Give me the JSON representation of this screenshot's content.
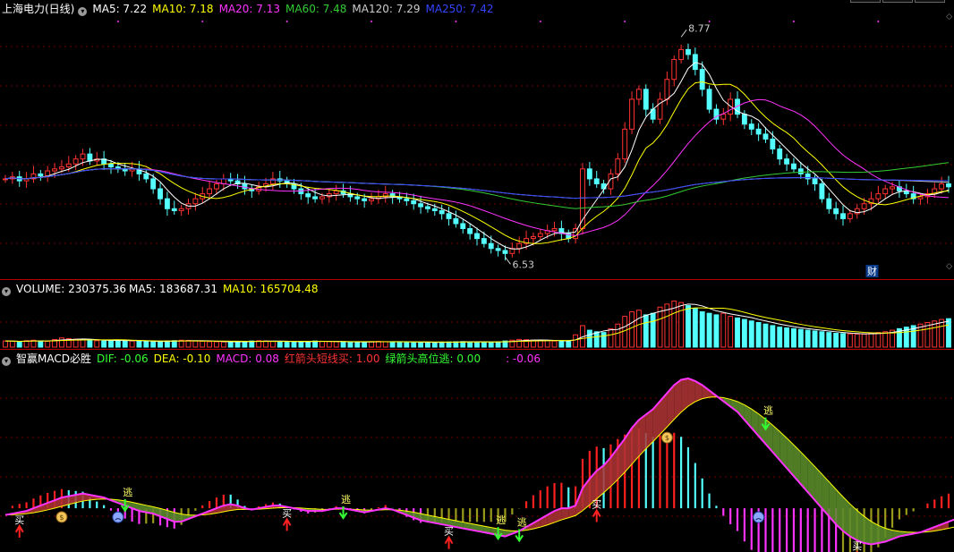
{
  "price": {
    "title": "上海电力(日线)",
    "ma": [
      {
        "label": "MA5: 7.22",
        "color": "#ffffff"
      },
      {
        "label": "MA10: 7.18",
        "color": "#ffff00"
      },
      {
        "label": "MA20: 7.13",
        "color": "#ff33ff"
      },
      {
        "label": "MA60: 7.48",
        "color": "#33cc33"
      },
      {
        "label": "MA120: 7.29",
        "color": "#cccccc"
      },
      {
        "label": "MA250: 7.42",
        "color": "#3344ff"
      }
    ],
    "high_label": "8.77",
    "low_label": "6.53",
    "cai_badge": "财"
  },
  "volume": {
    "items": [
      {
        "label": "VOLUME: 230375.36",
        "color": "#ffffff"
      },
      {
        "label": "MA5: 183687.31",
        "color": "#ffffff"
      },
      {
        "label": "MA10: 165704.48",
        "color": "#ffff00"
      }
    ]
  },
  "macd": {
    "title": "智赢MACD必胜",
    "items": [
      {
        "label": "DIF: -0.06",
        "color": "#33ff33"
      },
      {
        "label": "DEA: -0.10",
        "color": "#ffff00"
      },
      {
        "label": "MACD: 0.08",
        "color": "#ff33ff"
      },
      {
        "label": "红箭头短线买: 1.00",
        "color": "#ff3333"
      },
      {
        "label": "绿箭头高位逃: 0.00",
        "color": "#33ff33"
      },
      {
        "label": ": -0.06",
        "color": "#ff33ff"
      }
    ],
    "buy_label": "买",
    "sell_label": "逃"
  },
  "chart_data": {
    "type": "candlestick",
    "close": [
      7.3,
      7.32,
      7.28,
      7.3,
      7.35,
      7.33,
      7.38,
      7.4,
      7.42,
      7.45,
      7.5,
      7.55,
      7.48,
      7.5,
      7.45,
      7.42,
      7.4,
      7.38,
      7.4,
      7.35,
      7.3,
      7.2,
      7.1,
      7.0,
      6.98,
      7.0,
      7.05,
      7.1,
      7.15,
      7.2,
      7.25,
      7.3,
      7.28,
      7.25,
      7.2,
      7.18,
      7.22,
      7.25,
      7.3,
      7.28,
      7.25,
      7.2,
      7.15,
      7.12,
      7.1,
      7.12,
      7.15,
      7.18,
      7.15,
      7.12,
      7.1,
      7.08,
      7.1,
      7.12,
      7.15,
      7.12,
      7.1,
      7.08,
      7.05,
      7.02,
      7.0,
      6.98,
      6.95,
      6.9,
      6.85,
      6.8,
      6.75,
      6.7,
      6.65,
      6.6,
      6.58,
      6.55,
      6.6,
      6.65,
      6.7,
      6.72,
      6.75,
      6.78,
      6.8,
      6.75,
      6.7,
      6.8,
      7.4,
      7.3,
      7.25,
      7.2,
      7.35,
      7.5,
      7.8,
      8.1,
      8.2,
      8.0,
      7.9,
      8.1,
      8.3,
      8.5,
      8.6,
      8.55,
      8.4,
      8.2,
      8.0,
      7.9,
      7.95,
      8.1,
      7.95,
      7.85,
      7.8,
      7.75,
      7.7,
      7.6,
      7.5,
      7.45,
      7.4,
      7.35,
      7.3,
      7.25,
      7.1,
      7.0,
      6.95,
      6.9,
      6.95,
      7.0,
      7.05,
      7.1,
      7.15,
      7.2,
      7.22,
      7.18,
      7.15,
      7.1,
      7.12,
      7.15,
      7.2,
      7.25,
      7.22
    ],
    "ylim": [
      6.4,
      8.9
    ],
    "volume": [
      40,
      38,
      35,
      42,
      45,
      40,
      38,
      50,
      60,
      55,
      52,
      48,
      45,
      42,
      40,
      44,
      46,
      42,
      40,
      38,
      36,
      35,
      38,
      40,
      42,
      45,
      44,
      40,
      38,
      36,
      35,
      34,
      33,
      36,
      38,
      40,
      42,
      40,
      38,
      36,
      35,
      34,
      36,
      38,
      40,
      38,
      36,
      35,
      34,
      33,
      32,
      34,
      36,
      38,
      36,
      35,
      34,
      33,
      32,
      30,
      31,
      32,
      33,
      34,
      35,
      36,
      35,
      34,
      33,
      32,
      35,
      40,
      45,
      50,
      48,
      46,
      44,
      42,
      40,
      38,
      36,
      80,
      140,
      110,
      100,
      95,
      120,
      150,
      200,
      230,
      240,
      210,
      220,
      260,
      280,
      300,
      290,
      270,
      250,
      230,
      220,
      210,
      220,
      200,
      190,
      180,
      170,
      160,
      150,
      140,
      130,
      125,
      120,
      115,
      110,
      105,
      100,
      95,
      90,
      88,
      86,
      85,
      84,
      90,
      95,
      100,
      110,
      120,
      130,
      140,
      150,
      160,
      170,
      180,
      185
    ],
    "vlim": [
      0,
      320
    ],
    "dif": [
      -0.05,
      -0.04,
      -0.03,
      -0.02,
      0.0,
      0.02,
      0.04,
      0.06,
      0.08,
      0.09,
      0.1,
      0.11,
      0.1,
      0.09,
      0.08,
      0.06,
      0.04,
      0.02,
      0.0,
      -0.02,
      -0.03,
      -0.04,
      -0.06,
      -0.08,
      -0.1,
      -0.1,
      -0.08,
      -0.06,
      -0.04,
      -0.02,
      0.0,
      0.02,
      0.03,
      0.02,
      0.0,
      -0.01,
      0.0,
      0.01,
      0.02,
      0.02,
      0.01,
      0.0,
      -0.01,
      -0.02,
      -0.02,
      -0.02,
      -0.01,
      0.0,
      0.0,
      -0.01,
      -0.02,
      -0.03,
      -0.02,
      -0.01,
      0.0,
      -0.01,
      -0.03,
      -0.05,
      -0.07,
      -0.09,
      -0.1,
      -0.11,
      -0.12,
      -0.13,
      -0.14,
      -0.15,
      -0.16,
      -0.17,
      -0.18,
      -0.19,
      -0.2,
      -0.21,
      -0.19,
      -0.17,
      -0.14,
      -0.11,
      -0.08,
      -0.05,
      -0.02,
      0.0,
      0.0,
      0.02,
      0.15,
      0.22,
      0.28,
      0.32,
      0.38,
      0.45,
      0.52,
      0.6,
      0.66,
      0.7,
      0.74,
      0.8,
      0.86,
      0.92,
      0.96,
      0.97,
      0.95,
      0.92,
      0.88,
      0.84,
      0.8,
      0.76,
      0.72,
      0.66,
      0.6,
      0.54,
      0.48,
      0.42,
      0.36,
      0.3,
      0.24,
      0.18,
      0.12,
      0.06,
      0.0,
      -0.06,
      -0.12,
      -0.17,
      -0.21,
      -0.24,
      -0.26,
      -0.27,
      -0.26,
      -0.25,
      -0.23,
      -0.21,
      -0.2,
      -0.19,
      -0.18,
      -0.16,
      -0.14,
      -0.12,
      -0.1,
      -0.08,
      -0.06
    ],
    "mlim": [
      -0.3,
      1.05
    ],
    "signals": {
      "buy_idx": [
        2,
        40,
        63,
        84,
        121
      ],
      "sell_idx": [
        17,
        48,
        70,
        73,
        108
      ],
      "money_idx": [
        8,
        94
      ],
      "face_idx": [
        16,
        107
      ]
    }
  }
}
